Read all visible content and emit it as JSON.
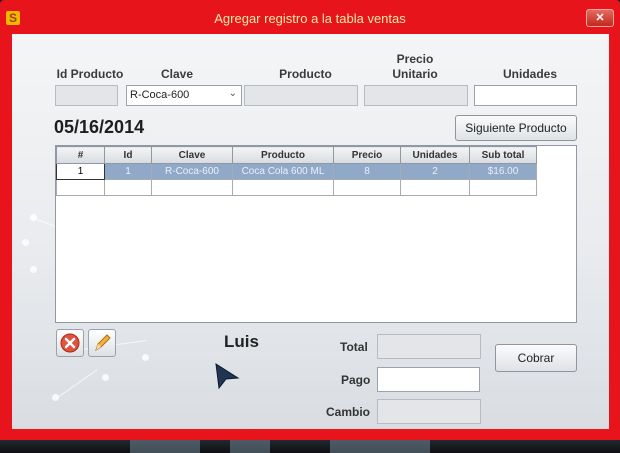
{
  "window": {
    "title": "Agregar registro a la tabla ventas",
    "app_icon": "S",
    "close_glyph": "✕"
  },
  "form": {
    "labels": {
      "id_producto": "Id Producto",
      "clave": "Clave",
      "producto": "Producto",
      "precio_unitario_1": "Precio",
      "precio_unitario_2": "Unitario",
      "unidades": "Unidades"
    },
    "clave_selected": "R-Coca-600",
    "date": "05/16/2014",
    "siguiente_label": "Siguiente Producto"
  },
  "grid": {
    "columns": [
      "#",
      "Id",
      "Clave",
      "Producto",
      "Precio",
      "Unidades",
      "Sub total"
    ],
    "rows": [
      {
        "num": "1",
        "id": "1",
        "clave": "R-Coca-600",
        "producto": "Coca Cola 600 ML",
        "precio": "8",
        "unidades": "2",
        "subtotal": "$16.00"
      }
    ]
  },
  "footer": {
    "user": "Luis",
    "total_label": "Total",
    "pago_label": "Pago",
    "cambio_label": "Cambio",
    "cobrar_label": "Cobrar"
  },
  "icons": {
    "delete": "x-circle-icon",
    "edit": "pencil-icon",
    "cursor": "mouse-pointer-icon"
  },
  "colors": {
    "frame": "#e8141c",
    "title_text": "#f7e9a4",
    "selected_row": "#91a9c9"
  }
}
